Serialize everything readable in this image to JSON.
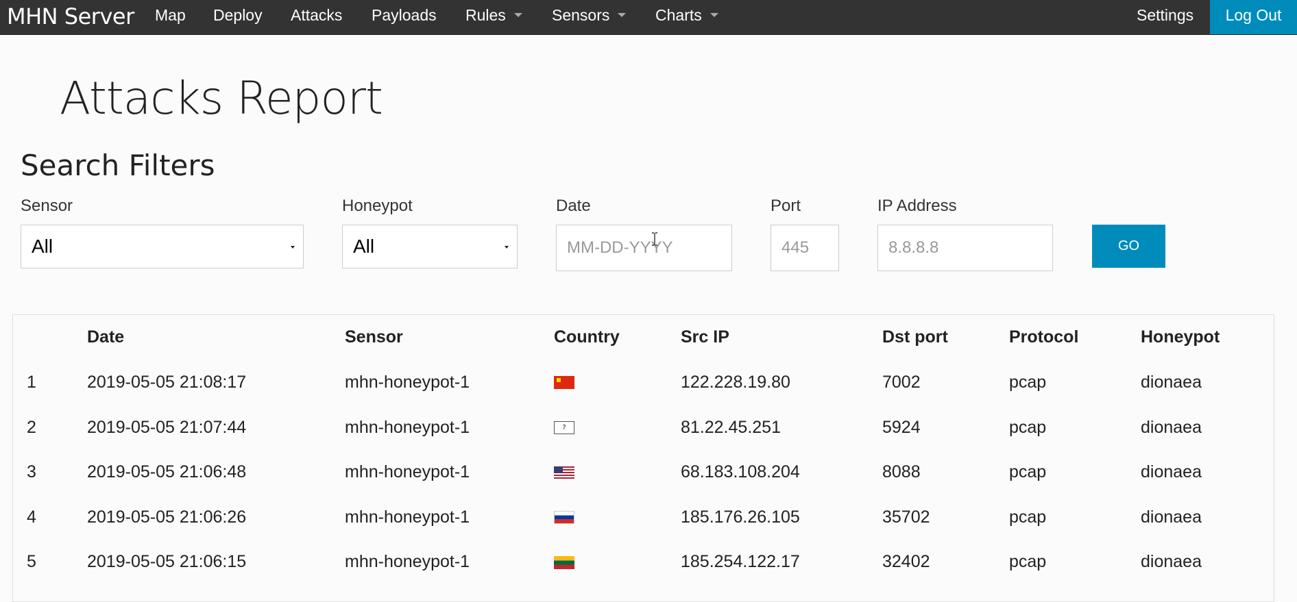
{
  "navbar": {
    "brand": "MHN Server",
    "items": [
      {
        "label": "Map"
      },
      {
        "label": "Deploy"
      },
      {
        "label": "Attacks"
      },
      {
        "label": "Payloads"
      },
      {
        "label": "Rules",
        "dropdown": true
      },
      {
        "label": "Sensors",
        "dropdown": true
      },
      {
        "label": "Charts",
        "dropdown": true
      }
    ],
    "settings": "Settings",
    "logout": "Log Out",
    "accent_color": "#008cba",
    "background_color": "#333333"
  },
  "page": {
    "title": "Attacks Report"
  },
  "filters": {
    "title": "Search Filters",
    "sensor": {
      "label": "Sensor",
      "value": "All"
    },
    "honeypot": {
      "label": "Honeypot",
      "value": "All"
    },
    "date": {
      "label": "Date",
      "placeholder": "MM-DD-YYYY",
      "value": ""
    },
    "port": {
      "label": "Port",
      "placeholder": "445",
      "value": ""
    },
    "ip": {
      "label": "IP Address",
      "placeholder": "8.8.8.8",
      "value": ""
    },
    "go": "GO"
  },
  "table": {
    "headers": {
      "num": "",
      "date": "Date",
      "sensor": "Sensor",
      "country": "Country",
      "src_ip": "Src IP",
      "dst_port": "Dst port",
      "protocol": "Protocol",
      "honeypot": "Honeypot"
    },
    "rows": [
      {
        "num": "1",
        "date": "2019-05-05 21:08:17",
        "sensor": "mhn-honeypot-1",
        "country": "china-flag-icon",
        "src_ip": "122.228.19.80",
        "dst_port": "7002",
        "protocol": "pcap",
        "honeypot": "dionaea"
      },
      {
        "num": "2",
        "date": "2019-05-05 21:07:44",
        "sensor": "mhn-honeypot-1",
        "country": "unknown-flag-icon",
        "unknown_glyph": "?",
        "src_ip": "81.22.45.251",
        "dst_port": "5924",
        "protocol": "pcap",
        "honeypot": "dionaea"
      },
      {
        "num": "3",
        "date": "2019-05-05 21:06:48",
        "sensor": "mhn-honeypot-1",
        "country": "us-flag-icon",
        "src_ip": "68.183.108.204",
        "dst_port": "8088",
        "protocol": "pcap",
        "honeypot": "dionaea"
      },
      {
        "num": "4",
        "date": "2019-05-05 21:06:26",
        "sensor": "mhn-honeypot-1",
        "country": "russia-flag-icon",
        "src_ip": "185.176.26.105",
        "dst_port": "35702",
        "protocol": "pcap",
        "honeypot": "dionaea"
      },
      {
        "num": "5",
        "date": "2019-05-05 21:06:15",
        "sensor": "mhn-honeypot-1",
        "country": "lithuania-flag-icon",
        "src_ip": "185.254.122.17",
        "dst_port": "32402",
        "protocol": "pcap",
        "honeypot": "dionaea"
      }
    ]
  }
}
